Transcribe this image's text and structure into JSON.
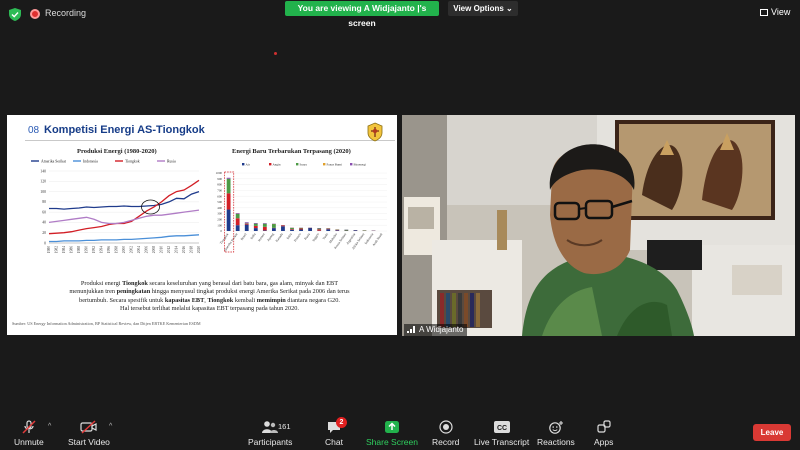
{
  "topbar": {
    "recording_label": "Recording",
    "viewing_label": "You are viewing A Widjajanto |'s screen",
    "view_options_label": "View Options ⌄",
    "view_label": "View"
  },
  "slide": {
    "number": "08",
    "title": "Kompetisi Energi AS-Tiongkok",
    "line_chart": {
      "title": "Produksi Energi (1980-2020)",
      "legend": [
        "Amerika Serikat",
        "Indonesia",
        "Tiongkok",
        "Rusia"
      ],
      "colors": [
        "#1f3b8c",
        "#4a8fd8",
        "#d21f26",
        "#b07cc6"
      ]
    },
    "bar_chart": {
      "title": "Energi Baru Terbarukan Terpasang (2020)",
      "legend": [
        "Air",
        "Angin",
        "Surya",
        "Panas Bumi",
        "Bioenergi"
      ],
      "colors": [
        "#1f3b8c",
        "#d21f26",
        "#4c9a45",
        "#e0a02a",
        "#8a4fb0"
      ]
    },
    "body_text": {
      "p1_a": "Produksi energi ",
      "p1_b": "Tiongkok",
      "p1_c": " secara keseluruhan yang berasal dari batu bara, gas alam, minyak dan EBT",
      "p2_a": "menunjukkan tren ",
      "p2_b": "peningkatan",
      "p2_c": " hingga menyusul tingkat produksi energi Amerika Serikat pada 2006 dan terus",
      "p3_a": "bertumbuh. Secara spesifik untuk ",
      "p3_b": "kapasitas EBT",
      "p3_c": ", ",
      "p3_d": "Tiongkok",
      "p3_e": " kembali ",
      "p3_f": "memimpin",
      "p3_g": " diantara negara G20.",
      "p4": "Hal tersebut terlihat melalui kapasitas EBT terpasang pada tahun 2020."
    },
    "source": "Sumber: US Energy Information Administration, BP Statistical Review, dan Ditjen EBTKE Kementerian ESDM"
  },
  "chart_data": [
    {
      "type": "line",
      "title": "Produksi Energi (1980-2020)",
      "x": [
        "1980",
        "1982",
        "1984",
        "1986",
        "1988",
        "1990",
        "1992",
        "1994",
        "1996",
        "1998",
        "2000",
        "2002",
        "2004",
        "2006",
        "2008",
        "2010",
        "2012",
        "2014",
        "2016",
        "2018",
        "2020"
      ],
      "ylim": [
        0,
        140
      ],
      "yticks": [
        0,
        20,
        40,
        60,
        80,
        100,
        120,
        140
      ],
      "series": [
        {
          "name": "Amerika Serikat",
          "values": [
            67,
            67,
            66,
            67,
            68,
            70,
            69,
            70,
            71,
            71,
            72,
            71,
            71,
            72,
            73,
            75,
            80,
            87,
            86,
            95,
            100
          ]
        },
        {
          "name": "Indonesia",
          "values": [
            3,
            3,
            4,
            4,
            4,
            5,
            5,
            6,
            6,
            6,
            7,
            7,
            8,
            9,
            10,
            11,
            13,
            14,
            14,
            15,
            16
          ]
        },
        {
          "name": "Tiongkok",
          "values": [
            18,
            19,
            20,
            22,
            25,
            28,
            30,
            32,
            36,
            38,
            38,
            42,
            52,
            62,
            70,
            80,
            92,
            100,
            103,
            112,
            122
          ]
        },
        {
          "name": "Rusia",
          "values": [
            40,
            42,
            44,
            46,
            48,
            50,
            46,
            40,
            38,
            38,
            40,
            44,
            48,
            52,
            54,
            54,
            56,
            58,
            60,
            62,
            64
          ]
        }
      ]
    },
    {
      "type": "bar",
      "title": "Energi Baru Terbarukan Terpasang (2020)",
      "ylim": [
        0,
        1000
      ],
      "yticks": [
        0,
        100,
        200,
        300,
        400,
        500,
        600,
        700,
        800,
        900,
        1000
      ],
      "categories": [
        "Tiongkok",
        "Amerika Serikat",
        "Brasil",
        "India",
        "Jerman",
        "Jepang",
        "Kanada",
        "Italia",
        "Prancis",
        "Rusia",
        "Inggris",
        "Turki",
        "Meksiko",
        "Korea Selatan",
        "Argentina",
        "Afrika Selatan",
        "Indonesia",
        "Arab Saudi"
      ],
      "series": [
        {
          "name": "Air",
          "values": [
            370,
            100,
            110,
            50,
            10,
            50,
            82,
            22,
            26,
            52,
            5,
            31,
            13,
            7,
            11,
            4,
            6,
            0
          ]
        },
        {
          "name": "Angin",
          "values": [
            280,
            120,
            17,
            38,
            62,
            4,
            14,
            11,
            18,
            1,
            24,
            9,
            7,
            2,
            3,
            3,
            0,
            0
          ]
        },
        {
          "name": "Surya",
          "values": [
            250,
            75,
            8,
            39,
            54,
            67,
            3,
            21,
            11,
            2,
            14,
            7,
            6,
            14,
            1,
            6,
            0,
            0
          ]
        },
        {
          "name": "Panas Bumi",
          "values": [
            0,
            3,
            0,
            0,
            0,
            1,
            0,
            1,
            0,
            0,
            0,
            2,
            1,
            0,
            0,
            0,
            2,
            0
          ]
        },
        {
          "name": "Bioenergi",
          "values": [
            18,
            12,
            16,
            11,
            10,
            5,
            2,
            4,
            3,
            1,
            8,
            1,
            1,
            1,
            1,
            0,
            2,
            0
          ]
        }
      ]
    }
  ],
  "video": {
    "participant_name": "A Widjajanto"
  },
  "toolbar": {
    "unmute": "Unmute",
    "start_video": "Start Video",
    "participants": "Participants",
    "participants_count": "161",
    "chat": "Chat",
    "chat_badge": "2",
    "share_screen": "Share Screen",
    "record": "Record",
    "live_transcript": "Live Transcript",
    "reactions": "Reactions",
    "apps": "Apps",
    "leave": "Leave"
  }
}
